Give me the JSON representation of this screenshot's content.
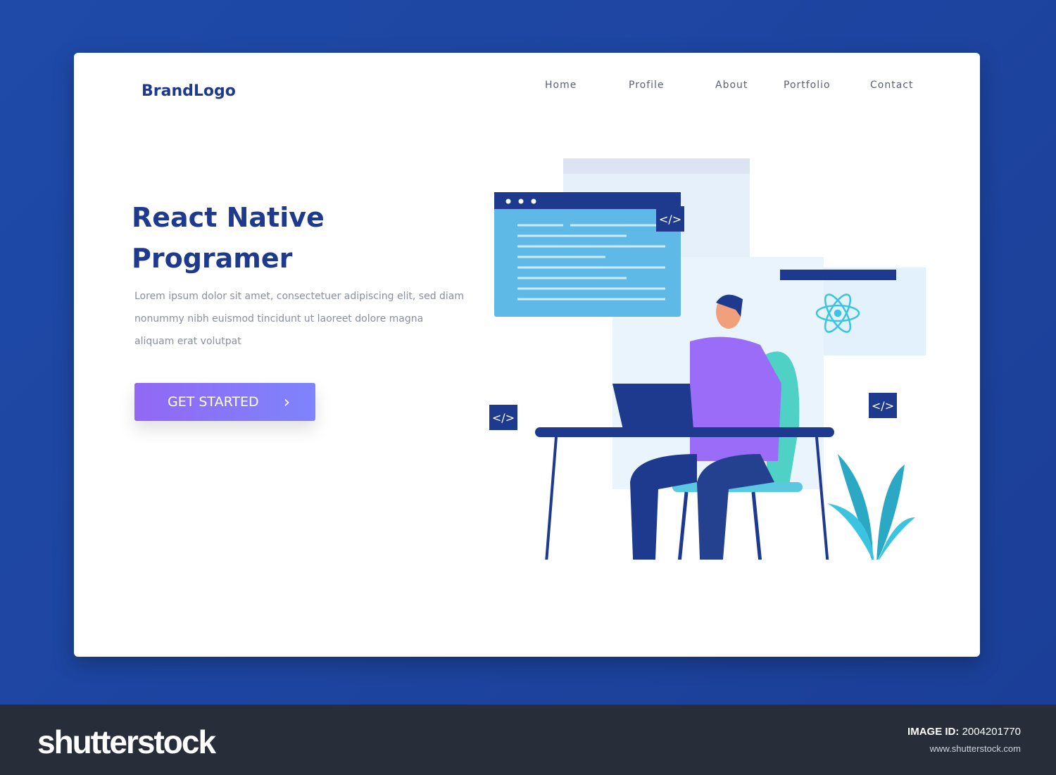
{
  "brand": "BrandLogo",
  "nav": [
    "Home",
    "Profile",
    "About",
    "Portfolio",
    "Contact"
  ],
  "hero": {
    "title_line1": "React Native",
    "title_line2": "Programer",
    "description": "Lorem ipsum dolor sit amet, consectetuer adipiscing elit, sed diam nonummy nibh euismod tincidunt ut laoreet dolore magna aliquam erat volutpat",
    "cta": "GET STARTED",
    "cta_icon": "chevron-right-icon"
  },
  "illustration": {
    "code_tag": "</>"
  },
  "footer": {
    "logo": "shutterstock",
    "image_id_label": "IMAGE ID:",
    "image_id": "2004201770",
    "url": "www.shutterstock.com"
  },
  "colors": {
    "primary": "#1e3a8f",
    "accent": "#8b6cf6",
    "background": "#1f4aa8"
  }
}
